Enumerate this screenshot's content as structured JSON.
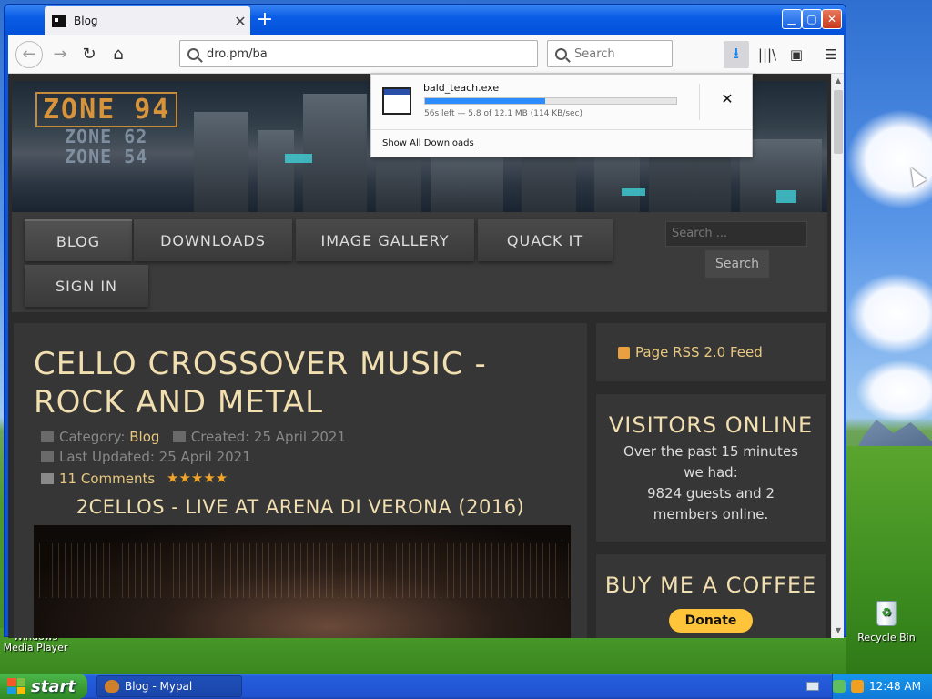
{
  "desktop": {
    "icons": [
      {
        "label": "Windows Media Player"
      },
      {
        "label": "Recycle Bin"
      }
    ]
  },
  "browser": {
    "tab": {
      "title": "Blog"
    },
    "url": "dro.pm/ba",
    "search_placeholder": "Search"
  },
  "download_panel": {
    "filename": "bald_teach.exe",
    "progress_fraction": 0.48,
    "status": "56s left — 5.8 of 12.1 MB (114 KB/sec)",
    "footer": "Show All Downloads"
  },
  "site": {
    "logo_main": "ZONE 94",
    "logo_sub": [
      "ZONE 62",
      "ZONE 54"
    ],
    "menu": [
      "BLOG",
      "DOWNLOADS",
      "IMAGE GALLERY",
      "QUACK IT",
      "SIGN IN"
    ],
    "search_placeholder": "Search ...",
    "search_button": "Search",
    "article": {
      "title": "CELLO CROSSOVER MUSIC - ROCK AND METAL",
      "category_label": "Category:",
      "category": "Blog",
      "created": "Created: 25 April 2021",
      "updated": "Last Updated: 25 April 2021",
      "comments": "11 Comments",
      "rating_stars": 5,
      "subtitle": "2CELLOS - LIVE AT ARENA DI VERONA (2016)"
    },
    "sidebar": {
      "rss": "Page RSS 2.0 Feed",
      "visitors_title": "VISITORS ONLINE",
      "visitors_text": "Over the past 15 minutes we had:",
      "visitors_count": "9824 guests and 2 members online.",
      "coffee_title": "BUY ME A COFFEE",
      "donate": "Donate"
    }
  },
  "taskbar": {
    "start": "start",
    "task": "Blog - Mypal",
    "clock": "12:48 AM"
  },
  "colors": {
    "accent_gold": "#f2dfb0",
    "link_gold": "#e8c880",
    "download_bar": "#2a8cff",
    "xp_blue": "#245edb",
    "start_green": "#3a9a30"
  }
}
